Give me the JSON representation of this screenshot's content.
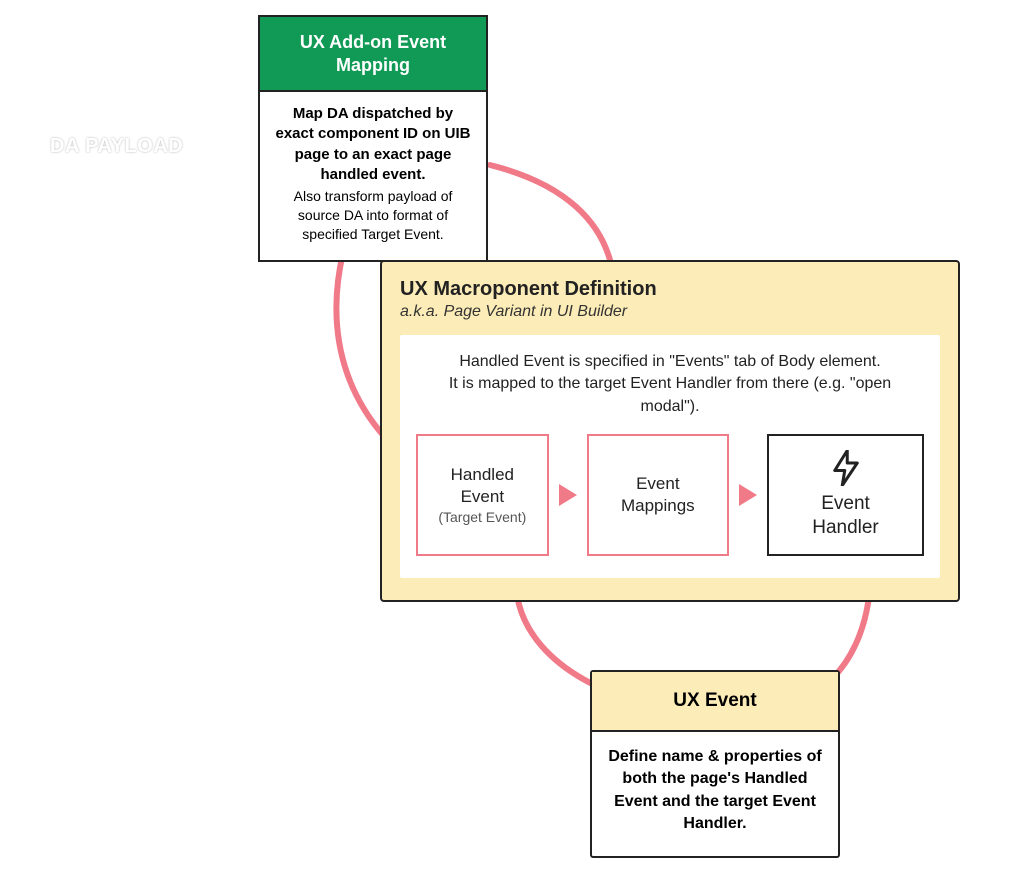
{
  "labels": {
    "da_payload": "DA PAYLOAD"
  },
  "addon": {
    "title": "UX Add-on Event Mapping",
    "body_main": "Map DA dispatched by exact component ID on UIB page to an exact page handled event.",
    "body_sub": "Also transform payload of source DA into format of specified Target Event."
  },
  "macro": {
    "title": "UX Macroponent Definition",
    "subtitle": "a.k.a. Page Variant in UI Builder",
    "desc": "Handled Event is specified in \"Events\" tab of Body element.\nIt is mapped to the target Event Handler from there (e.g. \"open modal\").",
    "handled_event_label": "Handled Event",
    "handled_event_sub": "(Target Event)",
    "event_mappings_label": "Event Mappings",
    "event_handler_label": "Event Handler"
  },
  "ux_event": {
    "title": "UX Event",
    "body": "Define name & properties of both the page's Handled Event and the target Event Handler."
  },
  "colors": {
    "green": "#119a55",
    "yellow": "#fcecb7",
    "pink": "#f17a89"
  }
}
